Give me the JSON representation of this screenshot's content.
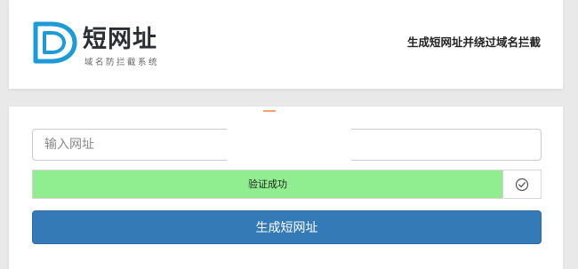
{
  "header": {
    "logo_title": "短网址",
    "logo_subtitle": "域名防拦截系统",
    "tagline": "生成短网址并绕过域名拦截"
  },
  "form": {
    "url_placeholder": "输入网址",
    "url_value": "",
    "verify_label": "验证成功",
    "verify_progress": 0.925,
    "verify_status_icon": "check-circle-icon",
    "generate_label": "生成短网址"
  },
  "colors": {
    "page_background": "#e9e9e9",
    "logo_blue": "#1e9bd7",
    "verify_success": "#90ee90",
    "button_primary": "#337ab7"
  }
}
